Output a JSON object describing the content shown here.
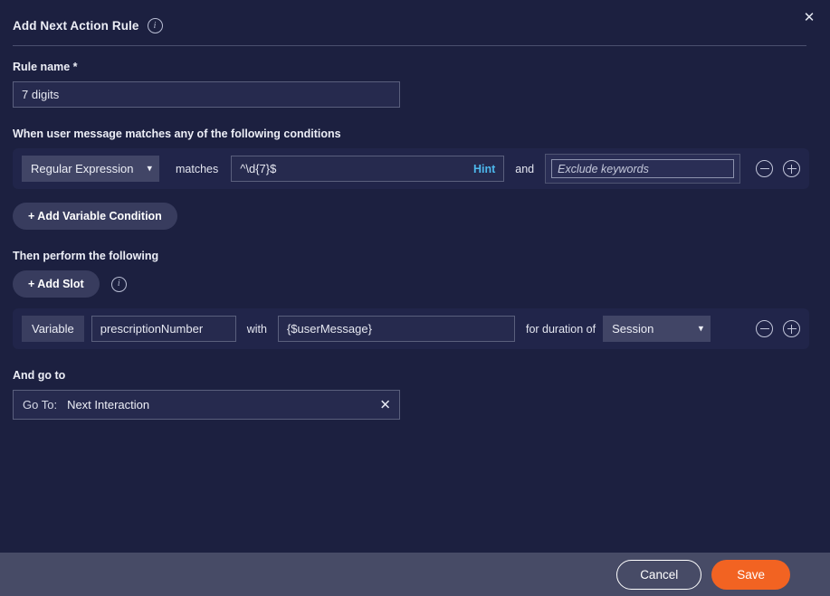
{
  "dialog": {
    "title": "Add Next Action Rule",
    "title_info_icon": "info-circle-icon",
    "close_icon": "close-icon"
  },
  "rule_name": {
    "label": "Rule name *",
    "value": "7 digits",
    "placeholder": ""
  },
  "conditions": {
    "heading": "When user message matches any of the following conditions",
    "rows": [
      {
        "type": "Regular Expression",
        "operator_label": "matches",
        "pattern": "^\\d{7}$",
        "hint_label": "Hint",
        "conjunction": "and",
        "exclude_value": "",
        "exclude_placeholder": "Exclude keywords",
        "remove_icon": "minus-circle-icon",
        "add_icon": "plus-circle-icon"
      }
    ],
    "add_variable_condition_label": "+ Add Variable Condition"
  },
  "actions": {
    "heading": "Then perform the following",
    "add_slot_label": "+ Add Slot",
    "add_slot_info_icon": "info-circle-icon",
    "rows": [
      {
        "kind": "Variable",
        "name": "prescriptionNumber",
        "with_label": "with",
        "value": "{$userMessage}",
        "duration_label": "for duration of",
        "duration": "Session",
        "remove_icon": "minus-circle-icon",
        "add_icon": "plus-circle-icon"
      }
    ]
  },
  "goto": {
    "heading": "And go to",
    "label": "Go To:",
    "value": "Next Interaction",
    "clear_icon": "close-icon"
  },
  "footer": {
    "cancel_label": "Cancel",
    "save_label": "Save"
  },
  "colors": {
    "background": "#1c2040",
    "footer_background": "#474b66",
    "row_card": "#21254a",
    "input_background": "#262a4e",
    "select_background": "#414566",
    "accent_save": "#f26322",
    "link_hint": "#4db8ec",
    "text_primary": "#e8eaf2"
  }
}
